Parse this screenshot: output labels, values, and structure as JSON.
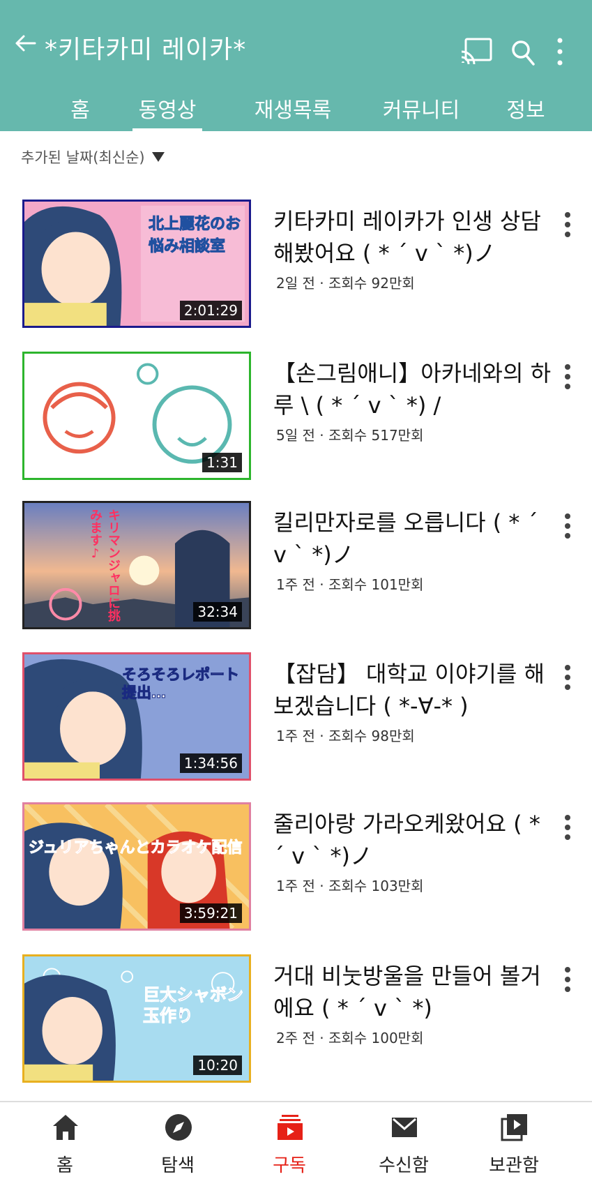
{
  "header": {
    "title": "*키타카미 레이카*",
    "tabs": [
      {
        "label": "홈"
      },
      {
        "label": "동영상"
      },
      {
        "label": "재생목록"
      },
      {
        "label": "커뮤니티"
      },
      {
        "label": "정보"
      }
    ],
    "active_tab": "동영상",
    "color": "#66b8ad"
  },
  "sort": {
    "label": "추가된 날짜(최신순)"
  },
  "videos": [
    {
      "title": "키타카미 레이카가 인생 상담해봤어요 ( * ´ v ` *)ノ",
      "meta": "2일 전 · 조회수 92만회",
      "duration": "2:01:29",
      "thumb_text": "北上麗花のお悩み相談室",
      "border_color": "#1a1a8c"
    },
    {
      "title": "【손그림애니】아카네와의 하루 \\ ( * ´ v ` *) /",
      "meta": "5일 전 · 조회수 517만회",
      "duration": "1:31",
      "thumb_text": "",
      "border_color": "#2db52d"
    },
    {
      "title": "킬리만자로를 오릅니다 ( * ´ v ` *)ノ",
      "meta": "1주 전 · 조회수 101만회",
      "duration": "32:34",
      "thumb_text": "キリマンジャロに挑みます♪",
      "border_color": "#222222"
    },
    {
      "title": "【잡담】 대학교 이야기를 해보겠습니다 ( *-∀-* )",
      "meta": "1주 전 · 조회수 98만회",
      "duration": "1:34:56",
      "thumb_text": "そろそろレポート提出…",
      "border_color": "#e0506a"
    },
    {
      "title": "줄리아랑 가라오케왔어요 ( * ´ v ` *)ノ",
      "meta": "1주 전 · 조회수 103만회",
      "duration": "3:59:21",
      "thumb_text": "ジュリアちゃんとカラオケ配信",
      "border_color": "#e080a0"
    },
    {
      "title": "거대 비눗방울을 만들어 볼거에요 ( * ´ v ` *)",
      "meta": "2주 전 · 조회수 100만회",
      "duration": "10:20",
      "thumb_text": "巨大シャボン玉作り",
      "border_color": "#e8b020"
    }
  ],
  "bottom_nav": [
    {
      "label": "홈",
      "icon": "home-icon"
    },
    {
      "label": "탐색",
      "icon": "explore-icon"
    },
    {
      "label": "구독",
      "icon": "subscriptions-icon",
      "active": true
    },
    {
      "label": "수신함",
      "icon": "inbox-icon"
    },
    {
      "label": "보관함",
      "icon": "library-icon"
    }
  ],
  "accent_color": "#e62117"
}
